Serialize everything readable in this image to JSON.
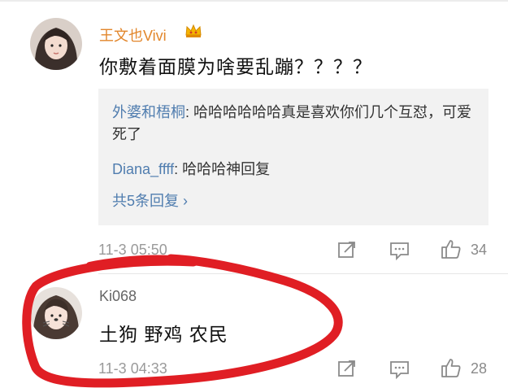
{
  "comments": [
    {
      "username": "王文也Vivi",
      "text": "你敷着面膜为啥要乱蹦？？？？",
      "time": "11-3 05:50",
      "likes": "34",
      "avatar_icon": "female-avatar-photo",
      "badge_icon": "vip-crown-icon",
      "replies": [
        {
          "author": "外婆和梧桐",
          "separator": ": ",
          "text": "哈哈哈哈哈哈真是喜欢你们几个互怼，可爱死了"
        },
        {
          "author": "Diana_ffff",
          "separator": ": ",
          "text": "哈哈哈神回复"
        }
      ],
      "reply_count_label": "共5条回复 ›"
    },
    {
      "username": "Ki068",
      "text": "土狗 野鸡 农民",
      "time": "11-3 04:33",
      "likes": "28",
      "avatar_icon": "female-avatar-photo"
    }
  ],
  "icons": {
    "share": "share-icon",
    "comment": "comment-icon",
    "like": "thumbs-up-icon"
  },
  "colors": {
    "vip_name": "#e2862b",
    "reply_author": "#507daf",
    "annotation": "#e01e24"
  }
}
